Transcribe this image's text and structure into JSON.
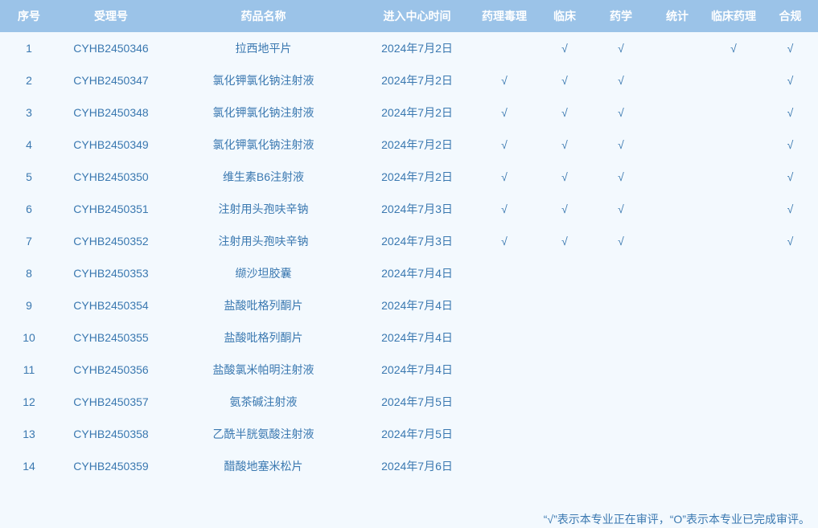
{
  "table": {
    "headers": [
      "序号",
      "受理号",
      "药品名称",
      "进入中心时间",
      "药理毒理",
      "临床",
      "药学",
      "统计",
      "临床药理",
      "合规"
    ],
    "rows": [
      [
        "1",
        "CYHB2450346",
        "拉西地平片",
        "2024年7月2日",
        "",
        "√",
        "√",
        "",
        "√",
        "√"
      ],
      [
        "2",
        "CYHB2450347",
        "氯化钾氯化钠注射液",
        "2024年7月2日",
        "√",
        "√",
        "√",
        "",
        "",
        "√"
      ],
      [
        "3",
        "CYHB2450348",
        "氯化钾氯化钠注射液",
        "2024年7月2日",
        "√",
        "√",
        "√",
        "",
        "",
        "√"
      ],
      [
        "4",
        "CYHB2450349",
        "氯化钾氯化钠注射液",
        "2024年7月2日",
        "√",
        "√",
        "√",
        "",
        "",
        "√"
      ],
      [
        "5",
        "CYHB2450350",
        "维生素B6注射液",
        "2024年7月2日",
        "√",
        "√",
        "√",
        "",
        "",
        "√"
      ],
      [
        "6",
        "CYHB2450351",
        "注射用头孢呋辛钠",
        "2024年7月3日",
        "√",
        "√",
        "√",
        "",
        "",
        "√"
      ],
      [
        "7",
        "CYHB2450352",
        "注射用头孢呋辛钠",
        "2024年7月3日",
        "√",
        "√",
        "√",
        "",
        "",
        "√"
      ],
      [
        "8",
        "CYHB2450353",
        "缬沙坦胶囊",
        "2024年7月4日",
        "",
        "",
        "",
        "",
        "",
        ""
      ],
      [
        "9",
        "CYHB2450354",
        "盐酸吡格列酮片",
        "2024年7月4日",
        "",
        "",
        "",
        "",
        "",
        ""
      ],
      [
        "10",
        "CYHB2450355",
        "盐酸吡格列酮片",
        "2024年7月4日",
        "",
        "",
        "",
        "",
        "",
        ""
      ],
      [
        "11",
        "CYHB2450356",
        "盐酸氯米帕明注射液",
        "2024年7月4日",
        "",
        "",
        "",
        "",
        "",
        ""
      ],
      [
        "12",
        "CYHB2450357",
        "氨茶碱注射液",
        "2024年7月5日",
        "",
        "",
        "",
        "",
        "",
        ""
      ],
      [
        "13",
        "CYHB2450358",
        "乙酰半胱氨酸注射液",
        "2024年7月5日",
        "",
        "",
        "",
        "",
        "",
        ""
      ],
      [
        "14",
        "CYHB2450359",
        "醋酸地塞米松片",
        "2024年7月6日",
        "",
        "",
        "",
        "",
        "",
        ""
      ]
    ]
  },
  "legend_note": "“√”表示本专业正在审评，“O”表示本专业已完成审评。",
  "colors": {
    "header_bg": "#9bc3e8",
    "header_text": "#ffffff",
    "body_bg": "#f3f9fe",
    "body_text": "#3a78b0"
  }
}
